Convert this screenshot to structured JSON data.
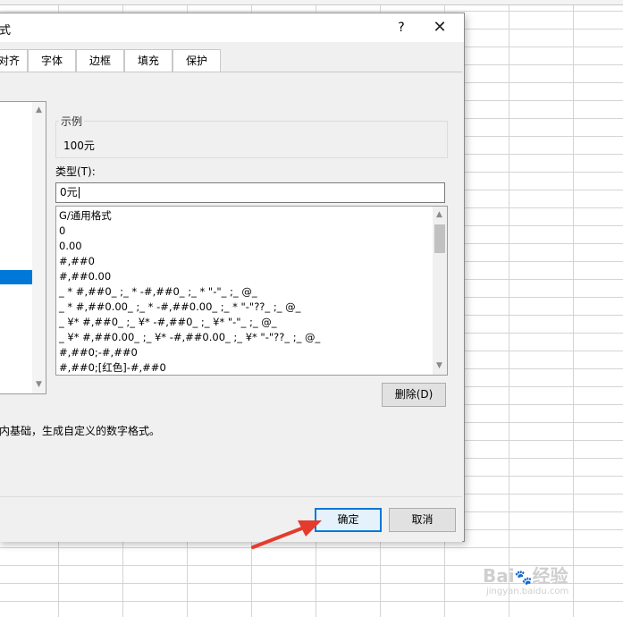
{
  "dialog": {
    "title": "式",
    "help": "?",
    "close": "✕"
  },
  "tabs": [
    {
      "label": "对齐"
    },
    {
      "label": "字体"
    },
    {
      "label": "边框"
    },
    {
      "label": "填充"
    },
    {
      "label": "保护"
    }
  ],
  "sample": {
    "label": "示例",
    "value": "100元"
  },
  "type": {
    "label": "类型(T):",
    "value": "0元"
  },
  "formats": [
    "G/通用格式",
    "0",
    "0.00",
    "#,##0",
    "#,##0.00",
    "_ * #,##0_ ;_ * -#,##0_ ;_ * \"-\"_ ;_ @_",
    "_ * #,##0.00_ ;_ * -#,##0.00_ ;_ * \"-\"??_ ;_ @_",
    "_ ¥* #,##0_ ;_ ¥* -#,##0_ ;_ ¥* \"-\"_ ;_ @_",
    "_ ¥* #,##0.00_ ;_ ¥* -#,##0.00_ ;_ ¥* \"-\"??_ ;_ @_",
    "#,##0;-#,##0",
    "#,##0;[红色]-#,##0"
  ],
  "buttons": {
    "delete": "删除(D)",
    "ok": "确定",
    "cancel": "取消"
  },
  "description": "内基础，生成自定义的数字格式。",
  "watermark": {
    "main": "Bai\u0000经验",
    "sub": "jingyan.baidu.com"
  },
  "colors": {
    "accent": "#0078d7",
    "arrow": "#e53b2c"
  }
}
